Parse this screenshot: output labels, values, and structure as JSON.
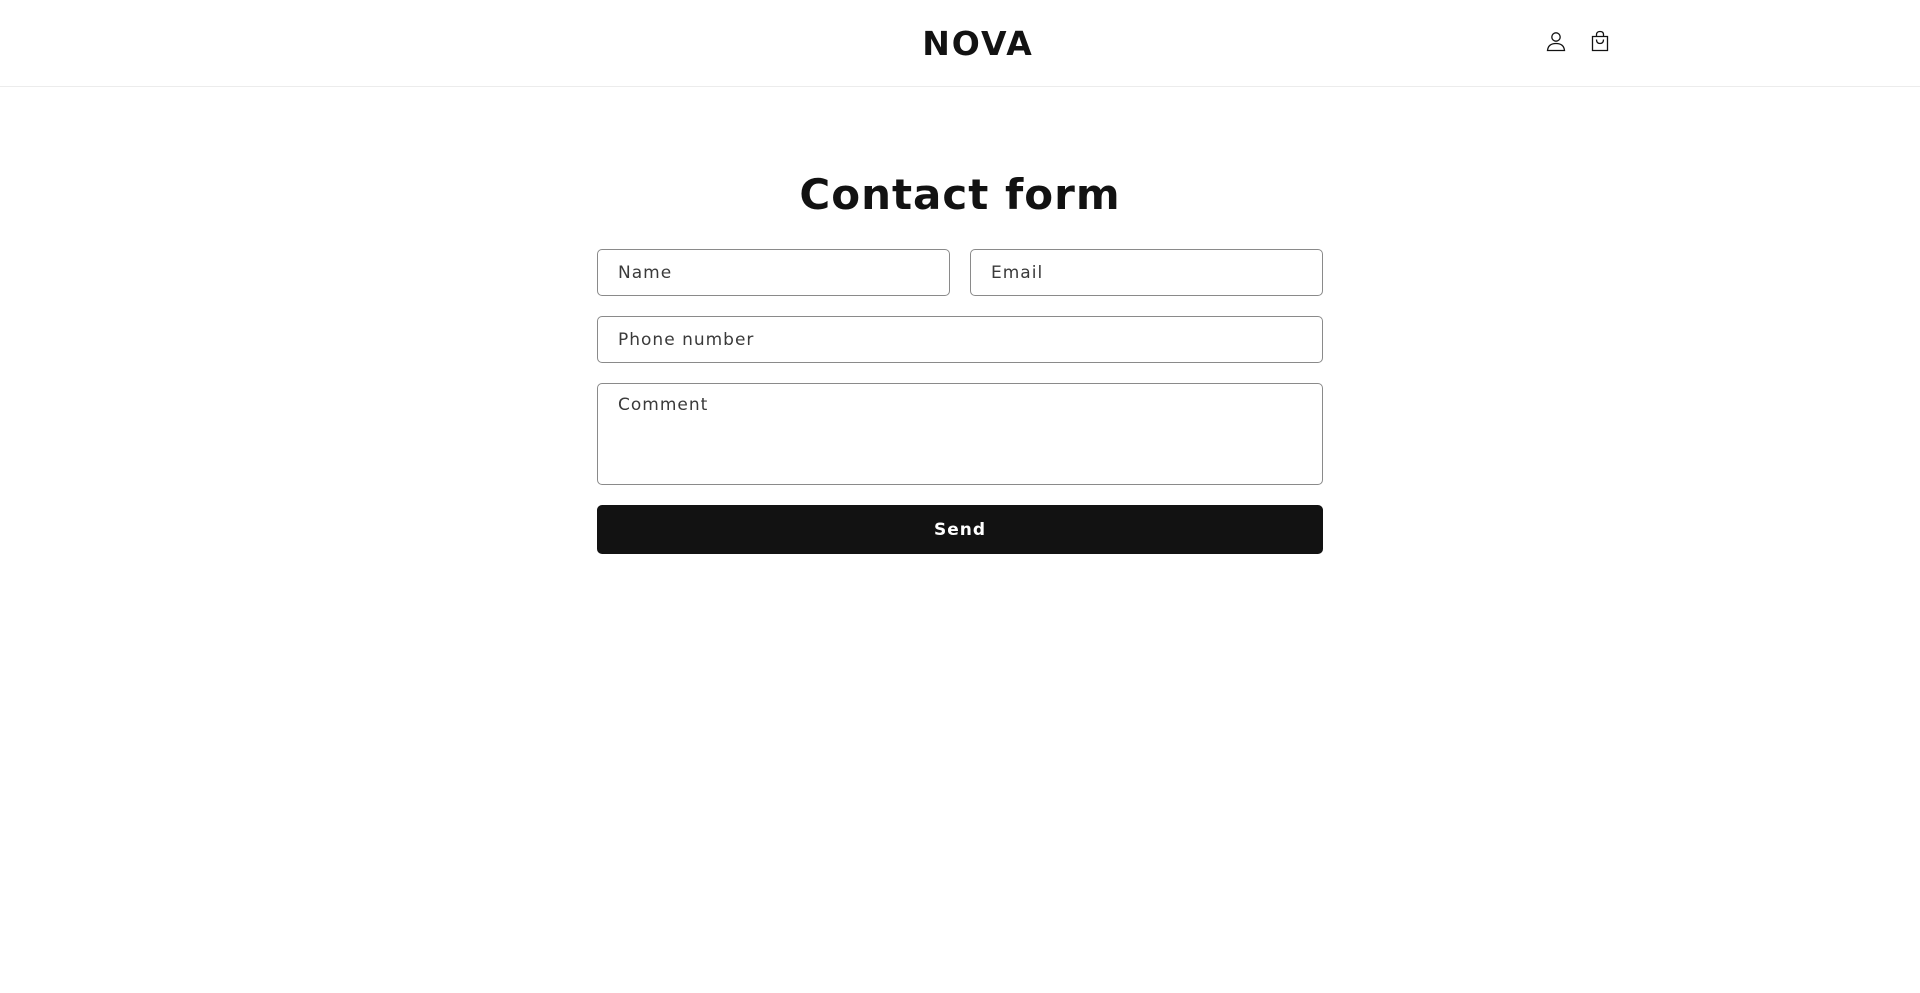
{
  "header": {
    "logo": "NOVA",
    "icons": {
      "account": "account-icon",
      "cart": "cart-icon"
    }
  },
  "main": {
    "title": "Contact form",
    "fields": {
      "name": {
        "placeholder": "Name",
        "value": ""
      },
      "email": {
        "placeholder": "Email",
        "value": ""
      },
      "phone": {
        "placeholder": "Phone number",
        "value": ""
      },
      "comment": {
        "placeholder": "Comment",
        "value": ""
      }
    },
    "send_label": "Send"
  },
  "colors": {
    "text": "#121212",
    "button_bg": "#121212",
    "button_text": "#ffffff",
    "field_border": "#8a8a8a",
    "header_border": "#ececec"
  }
}
